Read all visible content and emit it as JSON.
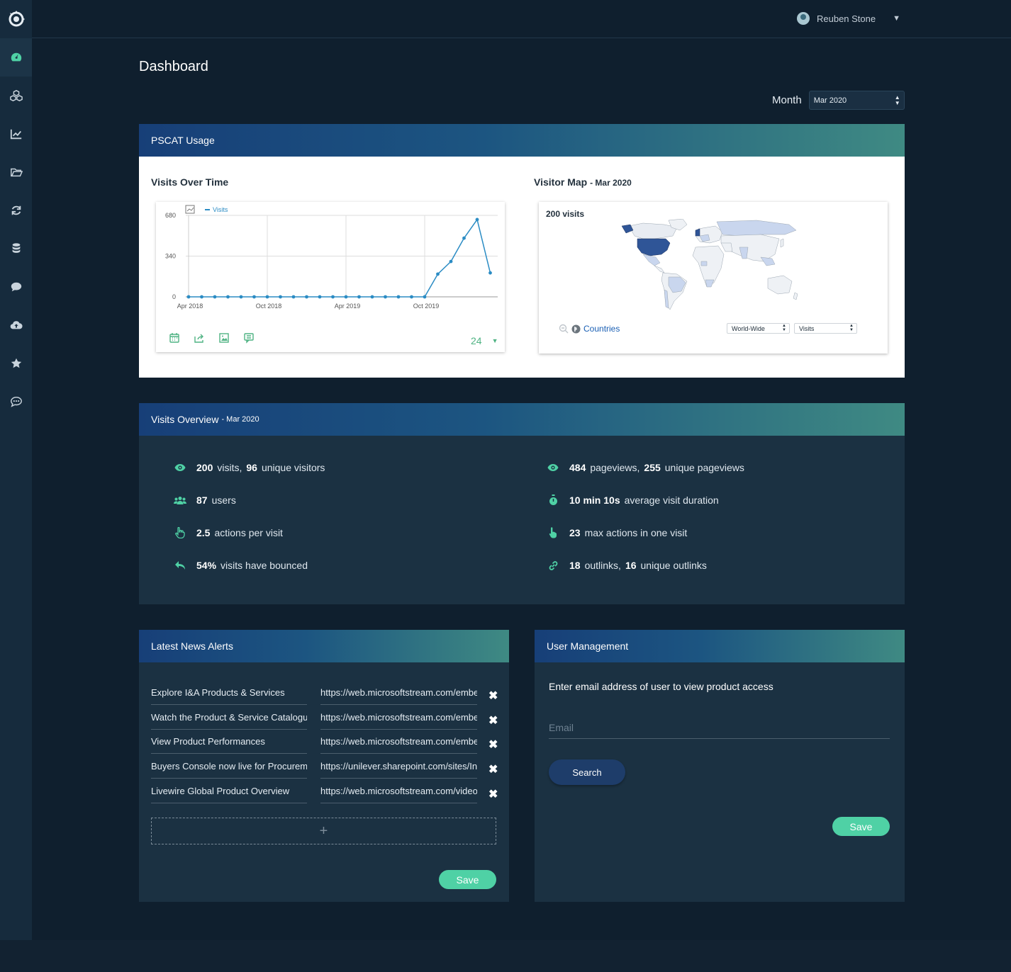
{
  "header": {
    "user_name": "Reuben Stone"
  },
  "sidebar": {
    "items": [
      {
        "name": "dashboard",
        "icon": "speedometer-icon",
        "active": true
      },
      {
        "name": "products",
        "icon": "cubes-icon"
      },
      {
        "name": "analytics",
        "icon": "line-chart-icon"
      },
      {
        "name": "files",
        "icon": "folder-open-icon"
      },
      {
        "name": "sync",
        "icon": "refresh-icon"
      },
      {
        "name": "database",
        "icon": "database-icon"
      },
      {
        "name": "comments",
        "icon": "comment-icon"
      },
      {
        "name": "upload",
        "icon": "cloud-upload-icon"
      },
      {
        "name": "favorites",
        "icon": "star-icon"
      },
      {
        "name": "chat",
        "icon": "chat-dots-icon"
      }
    ]
  },
  "page": {
    "title": "Dashboard",
    "month_label": "Month",
    "month_value": "Mar 2020"
  },
  "usage": {
    "panel_title": "PSCAT Usage",
    "visits_title": "Visits Over Time",
    "map_title": "Visitor Map",
    "map_title_suffix": "- Mar 2020",
    "map_visits": "200 visits",
    "map_countries_link": "Countries",
    "map_region_select": "World-Wide",
    "map_metric_select": "Visits",
    "period_count": "24"
  },
  "chart_data": {
    "type": "line",
    "legend": [
      "Visits"
    ],
    "x_tick_labels": [
      "Apr 2018",
      "Oct 2018",
      "Apr 2019",
      "Oct 2019"
    ],
    "y_tick_labels": [
      "0",
      "340",
      "680"
    ],
    "ylim": [
      0,
      680
    ],
    "series": [
      {
        "name": "Visits",
        "values": [
          0,
          0,
          0,
          0,
          0,
          0,
          0,
          0,
          0,
          0,
          0,
          0,
          0,
          0,
          0,
          0,
          0,
          0,
          0,
          190,
          295,
          490,
          645,
          200
        ]
      }
    ]
  },
  "overview": {
    "panel_title": "Visits Overview",
    "panel_suffix": "- Mar 2020",
    "left": [
      {
        "icon": "eye-icon",
        "v1": "200",
        "t1": "visits,",
        "v2": "96",
        "t2": "unique visitors"
      },
      {
        "icon": "users-icon",
        "v1": "87",
        "t1": "users"
      },
      {
        "icon": "hand-pointer-icon",
        "v1": "2.5",
        "t1": "actions per visit"
      },
      {
        "icon": "reply-icon",
        "v1": "54%",
        "t1": "visits have bounced"
      }
    ],
    "right": [
      {
        "icon": "eye-icon",
        "v1": "484",
        "t1": "pageviews,",
        "v2": "255",
        "t2": "unique pageviews"
      },
      {
        "icon": "stopwatch-icon",
        "v1": "10 min 10s",
        "t1": "average visit duration"
      },
      {
        "icon": "hand-point-up-icon",
        "v1": "23",
        "t1": "max actions in one visit"
      },
      {
        "icon": "link-icon",
        "v1": "18",
        "t1": "outlinks,",
        "v2": "16",
        "t2": "unique outlinks"
      }
    ]
  },
  "news": {
    "panel_title": "Latest News Alerts",
    "items": [
      {
        "title": "Explore I&A Products & Services",
        "url": "https://web.microsoftstream.com/embed"
      },
      {
        "title": "Watch the Product & Service Catalogue",
        "url": "https://web.microsoftstream.com/embed"
      },
      {
        "title": "View Product Performances",
        "url": "https://web.microsoftstream.com/embed"
      },
      {
        "title": "Buyers Console now live for Procurement",
        "url": "https://unilever.sharepoint.com/sites/In"
      },
      {
        "title": "Livewire Global Product Overview",
        "url": "https://web.microsoftstream.com/video"
      }
    ],
    "add_label": "+",
    "save_label": "Save"
  },
  "user_management": {
    "panel_title": "User Management",
    "instruction": "Enter email address of user to view product access",
    "email_placeholder": "Email",
    "search_label": "Search",
    "save_label": "Save"
  },
  "colors": {
    "accent": "#4fd1a5",
    "background": "#0f1f2e",
    "panel": "#1b3142",
    "chart_line": "#2b8cc4",
    "map_highlight": "#2f5597"
  }
}
